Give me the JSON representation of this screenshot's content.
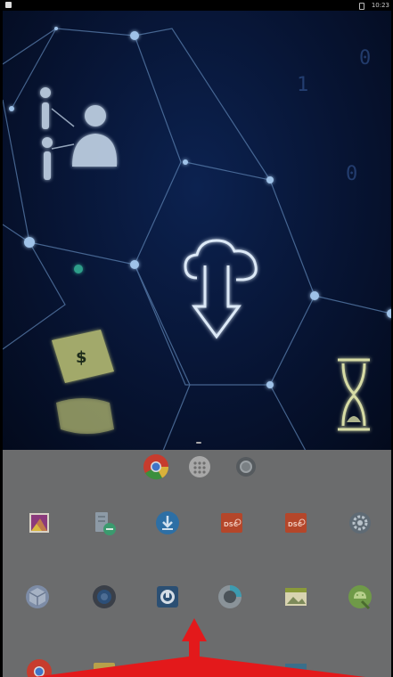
{
  "status_bar": {
    "time": "10:23"
  },
  "wallpaper": {
    "theme": "cloud-network",
    "accent": "#3a7fd0"
  },
  "drawer": {
    "dock": [
      "chrome-icon",
      "apps-grid-icon",
      "camera-icon"
    ],
    "row1": [
      "gallery-icon",
      "file-manager-icon",
      "download-icon",
      "dsc-app-icon",
      "dsc-app-icon",
      "settings-icon"
    ],
    "row2": [
      "cube-icon",
      "sound-icon",
      "screen-lock-icon",
      "speed-icon",
      "gallery-image-icon",
      "android-icon"
    ]
  },
  "colors": {
    "drawer_bg": "#6b6c6d",
    "arrow": "#e3191b"
  }
}
